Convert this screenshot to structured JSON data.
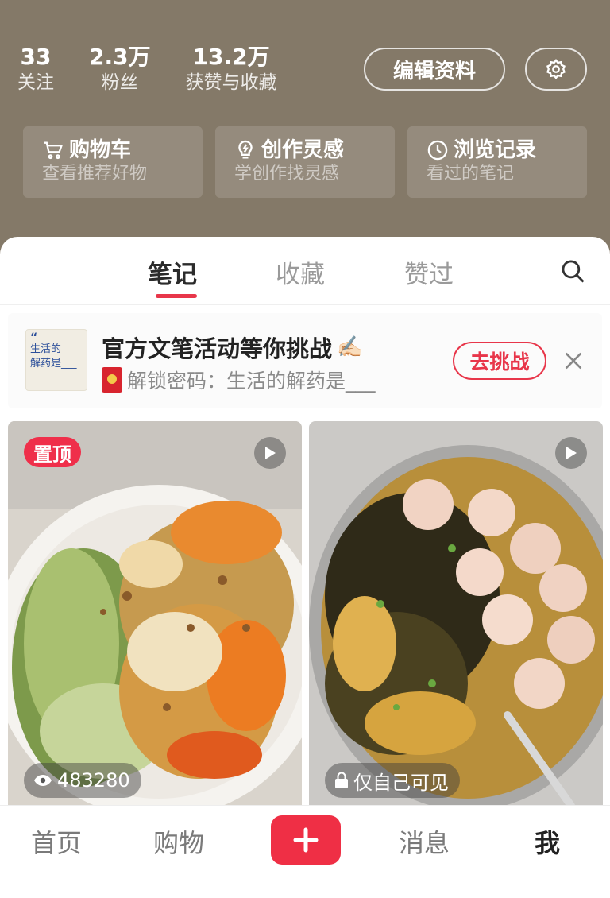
{
  "profile": {
    "stats": [
      {
        "value": "33",
        "label": "关注"
      },
      {
        "value": "2.3万",
        "label": "粉丝"
      },
      {
        "value": "13.2万",
        "label": "获赞与收藏"
      }
    ],
    "edit_label": "编辑资料",
    "settings_icon": "gear-icon"
  },
  "quick_cards": [
    {
      "icon": "cart-icon",
      "title": "购物车",
      "subtitle": "查看推荐好物"
    },
    {
      "icon": "lightbulb-icon",
      "title": "创作灵感",
      "subtitle": "学创作找灵感"
    },
    {
      "icon": "clock-icon",
      "title": "浏览记录",
      "subtitle": "看过的笔记"
    }
  ],
  "tabs": [
    {
      "label": "笔记",
      "active": true
    },
    {
      "label": "收藏",
      "active": false
    },
    {
      "label": "赞过",
      "active": false
    }
  ],
  "banner": {
    "thumb_quote": "“",
    "thumb_line1": "生活的",
    "thumb_line2": "解药是___",
    "title": "官方文笔活动等你挑战",
    "title_emoji": "✍🏻",
    "subtitle": "解锁密码：生活的解药是___",
    "action_label": "去挑战",
    "accent": "#e8364a"
  },
  "notes": [
    {
      "pinned_label": "置顶",
      "is_video": true,
      "views": "483280"
    },
    {
      "is_video": true,
      "visibility": "仅自己可见"
    }
  ],
  "bottom_nav": {
    "items": [
      "首页",
      "购物",
      "消息",
      "我"
    ],
    "active": "我",
    "publish_icon": "plus-icon"
  }
}
